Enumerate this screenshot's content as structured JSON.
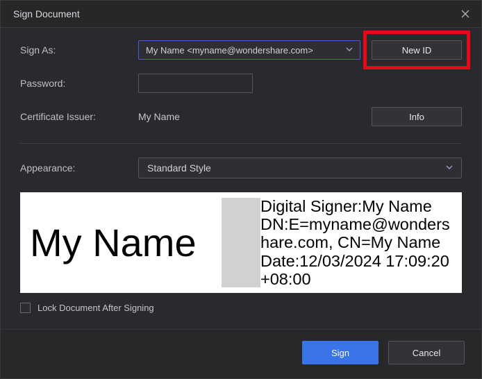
{
  "titlebar": {
    "title": "Sign Document"
  },
  "form": {
    "signAs": {
      "label": "Sign As:",
      "value": "My Name <myname@wondershare.com>",
      "newIdLabel": "New ID"
    },
    "password": {
      "label": "Password:",
      "value": ""
    },
    "certIssuer": {
      "label": "Certificate Issuer:",
      "value": "My Name",
      "infoLabel": "Info"
    },
    "appearance": {
      "label": "Appearance:",
      "value": "Standard Style"
    },
    "lockCheckbox": {
      "label": "Lock Document After Signing",
      "checked": false
    }
  },
  "preview": {
    "name": "My Name",
    "line1": "Digital Signer:My Name",
    "line2": "DN:E=myname@wondershare.com, CN=My Name",
    "line3": "Date:12/03/2024 17:09:20 +08:00"
  },
  "footer": {
    "sign": "Sign",
    "cancel": "Cancel"
  }
}
